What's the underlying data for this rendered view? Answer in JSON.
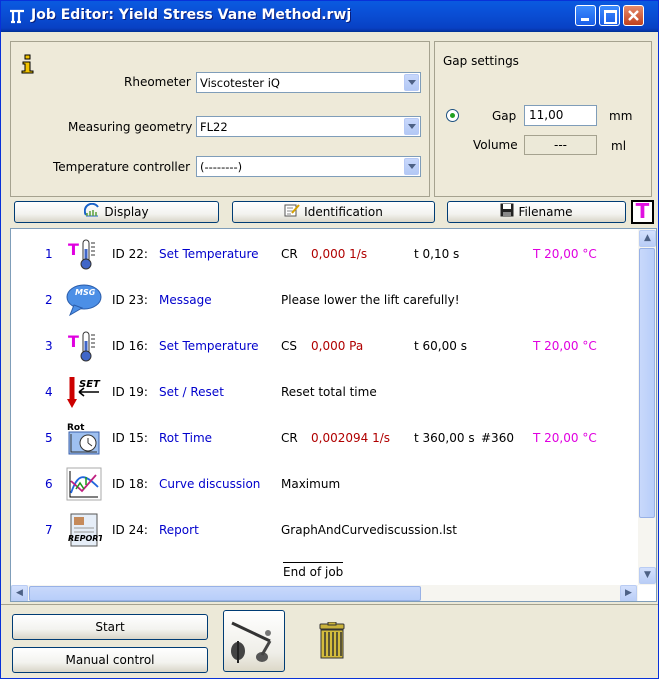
{
  "window": {
    "title": "Job Editor: Yield Stress Vane Method.rwj"
  },
  "setup": {
    "rheometer_label": "Rheometer",
    "rheometer_value": "Viscotester iQ",
    "geometry_label": "Measuring geometry",
    "geometry_value": "FL22",
    "temp_label": "Temperature controller",
    "temp_value": "(--------)"
  },
  "gap_settings": {
    "title": "Gap settings",
    "gap_label": "Gap",
    "gap_value": "11,00",
    "gap_unit": "mm",
    "volume_label": "Volume",
    "volume_value": "---",
    "volume_unit": "ml"
  },
  "toolbar": {
    "display": "Display",
    "identification": "Identification",
    "filename": "Filename",
    "t_label": "T"
  },
  "jobs": [
    {
      "num": "1",
      "icon": "set-temperature-icon",
      "id": "ID 22:",
      "name": "Set Temperature",
      "mode": "CR",
      "value": "0,000 1/s",
      "time": "t 0,10 s",
      "count": "",
      "temp": "T 20,00 °C",
      "detail": ""
    },
    {
      "num": "2",
      "icon": "message-icon",
      "id": "ID 23:",
      "name": "Message",
      "mode": "",
      "value": "",
      "time": "",
      "count": "",
      "temp": "",
      "detail": "Please lower the lift carefully!"
    },
    {
      "num": "3",
      "icon": "set-temperature-icon",
      "id": "ID 16:",
      "name": "Set Temperature",
      "mode": "CS",
      "value": "0,000 Pa",
      "time": "t 60,00 s",
      "count": "",
      "temp": "T 20,00 °C",
      "detail": ""
    },
    {
      "num": "4",
      "icon": "set-reset-icon",
      "id": "ID 19:",
      "name": "Set / Reset",
      "mode": "",
      "value": "",
      "time": "",
      "count": "",
      "temp": "",
      "detail": "Reset total time"
    },
    {
      "num": "5",
      "icon": "rot-time-icon",
      "id": "ID 15:",
      "name": "Rot Time",
      "mode": "CR",
      "value": "0,002094 1/s",
      "time": "t 360,00 s",
      "count": "#360",
      "temp": "T 20,00 °C",
      "detail": ""
    },
    {
      "num": "6",
      "icon": "curve-discussion-icon",
      "id": "ID 18:",
      "name": "Curve discussion",
      "mode": "",
      "value": "",
      "time": "",
      "count": "",
      "temp": "",
      "detail": "Maximum"
    },
    {
      "num": "7",
      "icon": "report-icon",
      "id": "ID 24:",
      "name": "Report",
      "mode": "",
      "value": "",
      "time": "",
      "count": "",
      "temp": "",
      "detail": "GraphAndCurvediscussion.lst"
    }
  ],
  "end_of_job": "End of job",
  "bottom": {
    "start": "Start",
    "manual": "Manual control"
  },
  "icons": {
    "msg_text": "MSG",
    "set_text": "SET",
    "rot_text": "Rot",
    "report_text": "REPORT"
  },
  "colors": {
    "accent_blue": "#0000CC",
    "value_red": "#B00000",
    "temp_magenta": "#E000E0"
  }
}
